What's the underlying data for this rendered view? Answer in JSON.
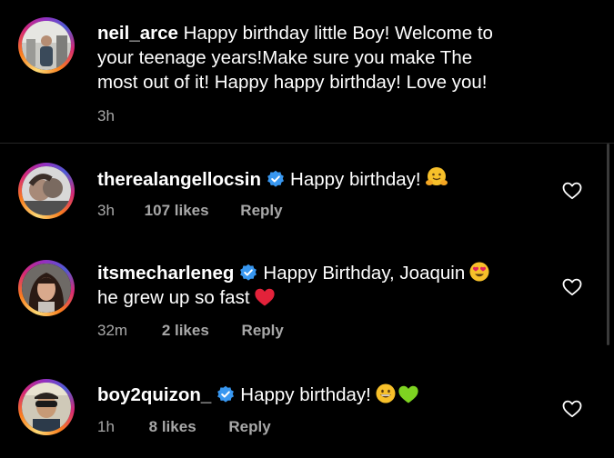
{
  "caption": {
    "username": "neil_arce",
    "lines": [
      "Happy birthday little Boy! Welcome to",
      "your teenage years!Make sure you make The",
      "most out of it! Happy happy birthday! Love you!"
    ],
    "time": "3h"
  },
  "comments": [
    {
      "username": "therealangellocsin",
      "verified": true,
      "text_line1": "Happy birthday!",
      "text_line2": "",
      "time": "3h",
      "likes": "107 likes",
      "reply": "Reply"
    },
    {
      "username": "itsmecharleneg",
      "verified": true,
      "text_line1": "Happy Birthday, Joaquin",
      "text_line2": "he grew up so fast",
      "time": "32m",
      "likes": "2 likes",
      "reply": "Reply"
    },
    {
      "username": "boy2quizon_",
      "verified": true,
      "text_line1": "Happy birthday!",
      "text_line2": "",
      "time": "1h",
      "likes": "8 likes",
      "reply": "Reply"
    }
  ],
  "colors": {
    "background": "#000000",
    "text": "#ffffff",
    "meta": "#a8a8a8",
    "verified": "#3897f0",
    "divider": "#262626"
  },
  "icons": [
    "heart-outline-icon",
    "verified-badge-icon",
    "hugging-face-emoji",
    "heart-eyes-emoji",
    "red-heart-emoji",
    "grinning-face-emoji",
    "green-heart-emoji"
  ]
}
